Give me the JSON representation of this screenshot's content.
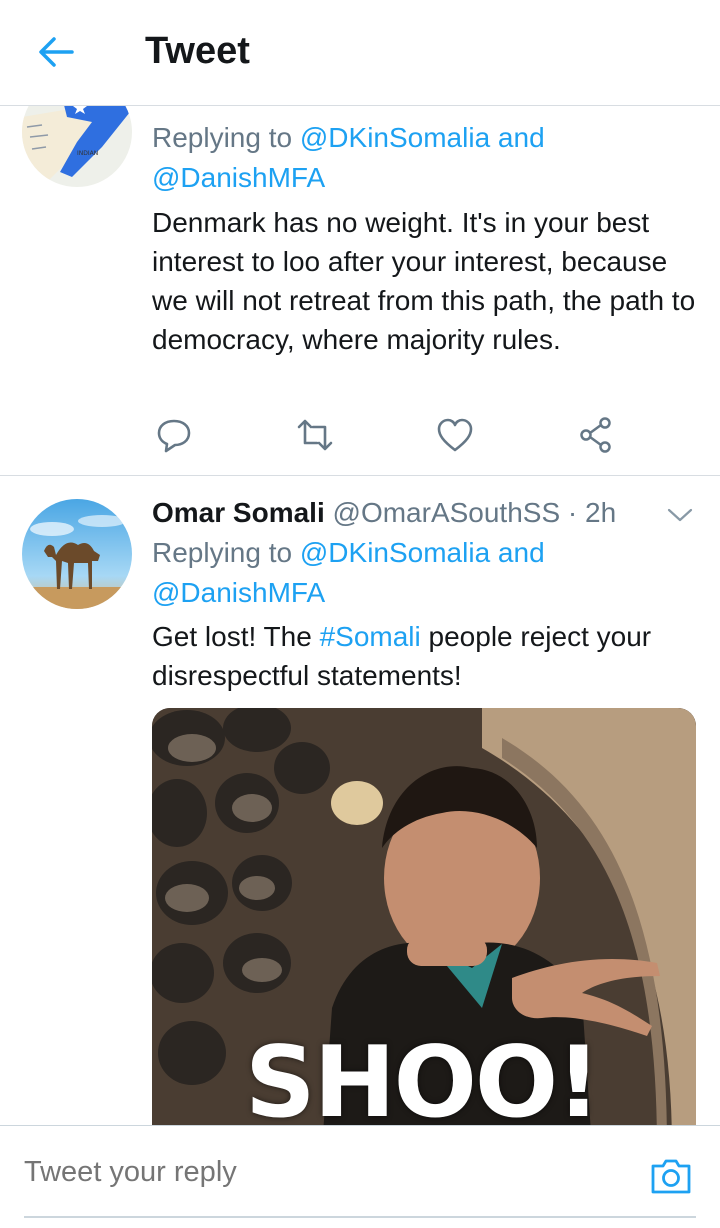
{
  "header": {
    "title": "Tweet"
  },
  "tweet1": {
    "replying_prefix": "Replying to",
    "mention1": "@DKinSomalia and",
    "mention2": "@DanishMFA",
    "text": "Denmark has no weight. It's in your best interest to loo after your interest, because we will not retreat from this path, the path to democracy, where majority rules."
  },
  "tweet2": {
    "name": "Omar Somali",
    "handle": "@OmarASouthSS",
    "separator": "·",
    "time": "2h",
    "replying_prefix": "Replying to",
    "mention1": "@DKinSomalia and",
    "mention2": "@DanishMFA",
    "text_before": "Get lost! The",
    "hashtag": "#Somali",
    "text_after": "people reject your disrespectful  statements!",
    "media_caption": "SHOO!"
  },
  "composer": {
    "placeholder": "Tweet your reply"
  },
  "colors": {
    "accent": "#1da1f2",
    "secondary_text": "#657786",
    "primary_text": "#14171a"
  },
  "icons": [
    "back-arrow-icon",
    "reply-icon",
    "retweet-icon",
    "like-icon",
    "share-icon",
    "chevron-down-icon",
    "camera-icon"
  ]
}
